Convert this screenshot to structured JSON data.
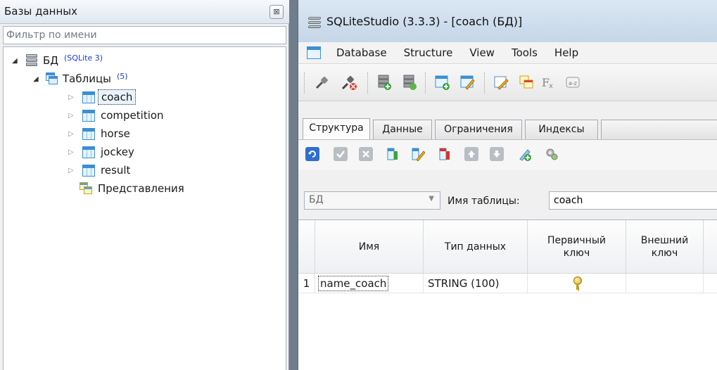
{
  "left_panel": {
    "title": "Базы данных",
    "close_glyph": "⊠",
    "filter_placeholder": "Фильтр по имени",
    "tree": {
      "database": {
        "name": "БД",
        "driver": "(SQLite 3)"
      },
      "tables_group": {
        "label": "Таблицы",
        "count": "(5)"
      },
      "tables": [
        {
          "name": "coach",
          "selected": true
        },
        {
          "name": "competition"
        },
        {
          "name": "horse"
        },
        {
          "name": "jockey"
        },
        {
          "name": "result"
        }
      ],
      "views_group": {
        "label": "Представления"
      }
    }
  },
  "window": {
    "title": "SQLiteStudio (3.3.3) - [coach (БД)]",
    "menu": [
      "Database",
      "Structure",
      "View",
      "Tools",
      "Help"
    ],
    "toolbar_icons": [
      "connect-icon",
      "disconnect-icon",
      "add-database-icon",
      "edit-database-icon",
      "new-table-icon",
      "edit-table-icon",
      "new-view-icon",
      "function-icon",
      "collations-icon"
    ],
    "tabs": [
      "Структура",
      "Данные",
      "Ограничения",
      "Индексы"
    ],
    "structure_toolbar_icons": [
      "refresh-icon",
      "commit-icon",
      "rollback-icon",
      "add-column-icon",
      "edit-column-icon",
      "delete-column-icon",
      "move-up-icon",
      "move-down-icon",
      "add-constraint-icon",
      "settings-icon"
    ],
    "database_combo": "БД",
    "table_name_label": "Имя таблицы:",
    "table_name_value": "coach",
    "columns_table": {
      "headers": [
        "Имя",
        "Тип данных",
        "Первичный ключ",
        "Внешний ключ"
      ],
      "rows": [
        {
          "num": "1",
          "name": "name_coach",
          "type": "STRING (100)",
          "primary_key": true,
          "foreign_key": ""
        }
      ]
    }
  }
}
